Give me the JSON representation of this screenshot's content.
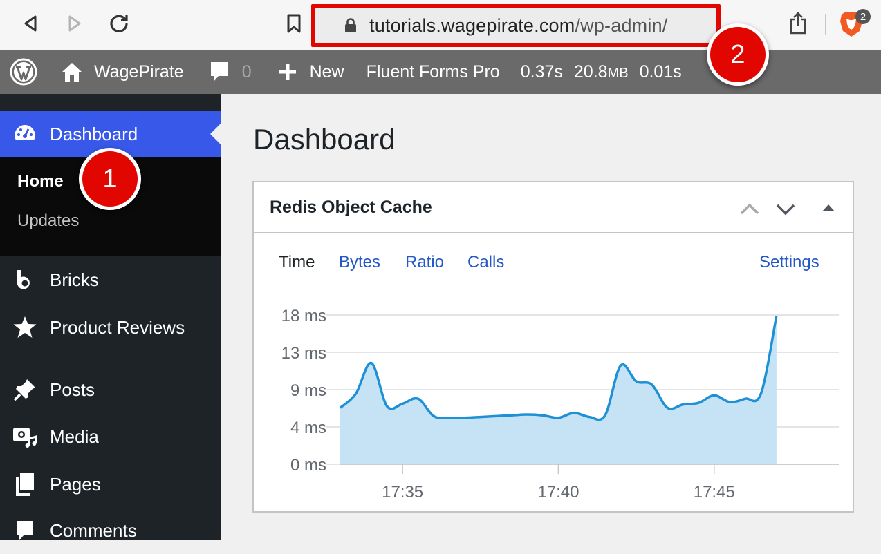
{
  "browser": {
    "url_host": "tutorials.wagepirate.com",
    "url_path": "/wp-admin/",
    "extension_badge": "2"
  },
  "adminbar": {
    "site_name": "WagePirate",
    "comments_count": "0",
    "new_label": "New",
    "plugin_label": "Fluent Forms Pro",
    "stat_time": "0.37s",
    "stat_memory_num": "20.8",
    "stat_memory_unit": "MB",
    "stat_query": "0.01s"
  },
  "sidebar": {
    "active_label": "Dashboard",
    "submenu": [
      "Home",
      "Updates"
    ],
    "items": [
      "Bricks",
      "Product Reviews",
      "Posts",
      "Media",
      "Pages",
      "Comments"
    ]
  },
  "main": {
    "title": "Dashboard"
  },
  "widget": {
    "title": "Redis Object Cache",
    "tabs": [
      "Time",
      "Bytes",
      "Ratio",
      "Calls"
    ],
    "settings_label": "Settings"
  },
  "chart_data": {
    "type": "area",
    "title": "",
    "xlabel": "",
    "ylabel": "",
    "y_ticks": [
      "0 ms",
      "4 ms",
      "9 ms",
      "13 ms",
      "18 ms"
    ],
    "y_tick_values": [
      0,
      4.5,
      9,
      13.5,
      18
    ],
    "ylim": [
      0,
      18
    ],
    "x_ticks": [
      "17:35",
      "17:40",
      "17:45"
    ],
    "x_tick_values": [
      2,
      7,
      12
    ],
    "xlim": [
      0,
      16
    ],
    "grid": true,
    "series": [
      {
        "color": "#1e90d6",
        "fill": "#c5e3f4",
        "x": [
          0,
          0.5,
          1,
          1.5,
          2,
          2.5,
          3,
          3.5,
          4,
          4.5,
          5,
          5.5,
          6,
          6.5,
          7,
          7.5,
          8,
          8.5,
          9,
          9.5,
          10,
          10.5,
          11,
          11.5,
          12,
          12.5,
          13,
          13.5,
          14,
          14.5,
          15,
          15.5,
          16
        ],
        "values": [
          6.8,
          8.5,
          12.2,
          7.0,
          7.3,
          7.9,
          5.8,
          5.6,
          5.6,
          5.7,
          5.8,
          5.9,
          6.0,
          5.9,
          5.6,
          6.2,
          5.7,
          5.9,
          11.9,
          10.0,
          9.6,
          6.8,
          7.2,
          7.4,
          8.3,
          7.5,
          7.9,
          8.5,
          17.9,
          0,
          0,
          0,
          0
        ]
      }
    ]
  },
  "annotations": {
    "badge_1": "1",
    "badge_2": "2"
  }
}
